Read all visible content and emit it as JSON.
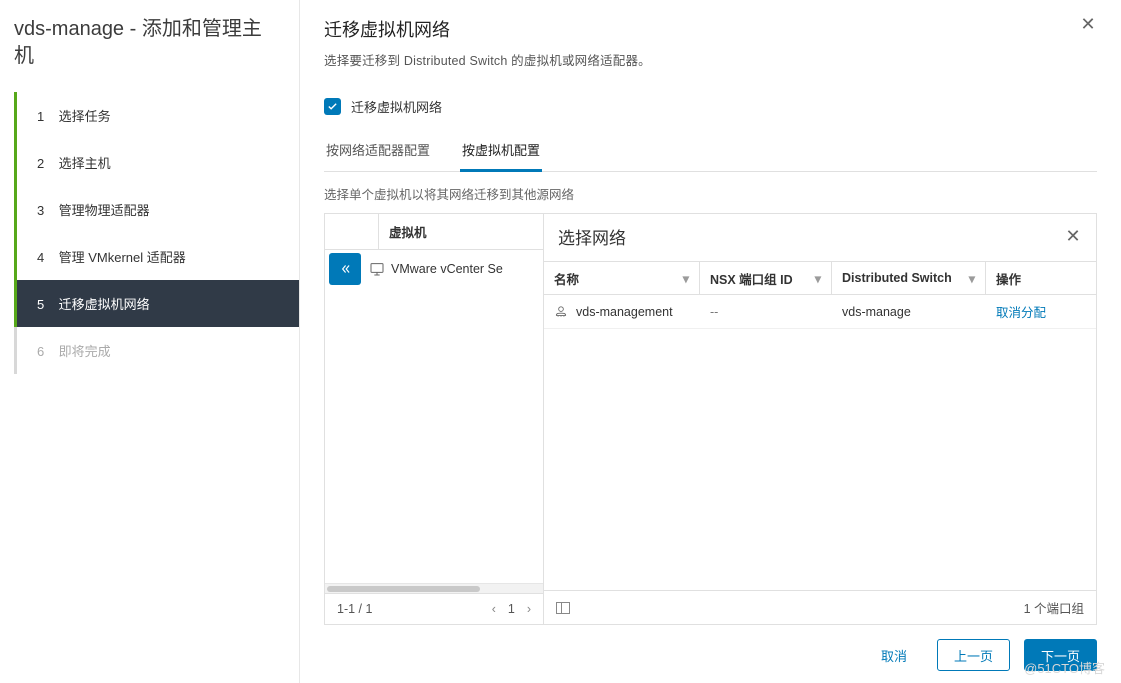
{
  "wizard_title": "vds-manage - 添加和管理主机",
  "steps": [
    {
      "num": "1",
      "label": "选择任务",
      "state": "done"
    },
    {
      "num": "2",
      "label": "选择主机",
      "state": "done"
    },
    {
      "num": "3",
      "label": "管理物理适配器",
      "state": "done"
    },
    {
      "num": "4",
      "label": "管理 VMkernel 适配器",
      "state": "done"
    },
    {
      "num": "5",
      "label": "迁移虚拟机网络",
      "state": "active"
    },
    {
      "num": "6",
      "label": "即将完成",
      "state": "pending"
    }
  ],
  "page": {
    "title": "迁移虚拟机网络",
    "subtitle": "选择要迁移到 Distributed Switch 的虚拟机或网络适配器。",
    "checkbox_label": "迁移虚拟机网络",
    "checkbox_checked": true,
    "tabs": [
      {
        "label": "按网络适配器配置",
        "active": false
      },
      {
        "label": "按虚拟机配置",
        "active": true
      }
    ],
    "hint": "选择单个虚拟机以将其网络迁移到其他源网络"
  },
  "vm_panel": {
    "header": "虚拟机",
    "rows": [
      {
        "name": "VMware vCenter Se"
      }
    ],
    "pager": {
      "range": "1-1 / 1",
      "page": "1"
    }
  },
  "network_panel": {
    "title": "选择网络",
    "columns": {
      "name": "名称",
      "nsx": "NSX 端口组 ID",
      "ds": "Distributed Switch",
      "op": "操作"
    },
    "rows": [
      {
        "name": "vds-management",
        "nsx": "--",
        "ds": "vds-manage",
        "op": "取消分配"
      }
    ],
    "count": "1 个端口组"
  },
  "footer": {
    "cancel": "取消",
    "prev": "上一页",
    "next": "下一页"
  },
  "watermark": "@51CTO博客"
}
